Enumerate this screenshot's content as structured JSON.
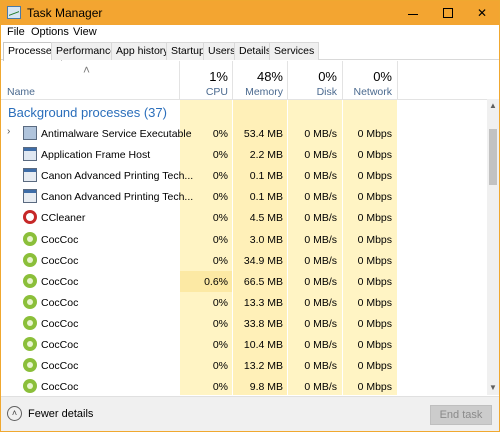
{
  "window": {
    "title": "Task Manager"
  },
  "menu": [
    "File",
    "Options",
    "View"
  ],
  "tabs": [
    "Processes",
    "Performance",
    "App history",
    "Startup",
    "Users",
    "Details",
    "Services"
  ],
  "active_tab": "Processes",
  "columns": {
    "name": "Name",
    "cpu": {
      "pct": "1%",
      "label": "CPU"
    },
    "memory": {
      "pct": "48%",
      "label": "Memory"
    },
    "disk": {
      "pct": "0%",
      "label": "Disk"
    },
    "network": {
      "pct": "0%",
      "label": "Network"
    }
  },
  "group": {
    "title": "Background processes (37)"
  },
  "rows": [
    {
      "name": "Antimalware Service Executable",
      "icon": "shield-icon",
      "expandable": true,
      "cpu": "0%",
      "memory": "53.4 MB",
      "disk": "0 MB/s",
      "network": "0 Mbps"
    },
    {
      "name": "Application Frame Host",
      "icon": "app-frame-icon",
      "expandable": false,
      "cpu": "0%",
      "memory": "2.2 MB",
      "disk": "0 MB/s",
      "network": "0 Mbps"
    },
    {
      "name": "Canon Advanced Printing Tech...",
      "icon": "canon-icon",
      "expandable": false,
      "cpu": "0%",
      "memory": "0.1 MB",
      "disk": "0 MB/s",
      "network": "0 Mbps"
    },
    {
      "name": "Canon Advanced Printing Tech...",
      "icon": "canon-icon",
      "expandable": false,
      "cpu": "0%",
      "memory": "0.1 MB",
      "disk": "0 MB/s",
      "network": "0 Mbps"
    },
    {
      "name": "CCleaner",
      "icon": "ccleaner-icon",
      "expandable": false,
      "cpu": "0%",
      "memory": "4.5 MB",
      "disk": "0 MB/s",
      "network": "0 Mbps"
    },
    {
      "name": "CocCoc",
      "icon": "coccoc-icon",
      "expandable": false,
      "cpu": "0%",
      "memory": "3.0 MB",
      "disk": "0 MB/s",
      "network": "0 Mbps"
    },
    {
      "name": "CocCoc",
      "icon": "coccoc-icon",
      "expandable": false,
      "cpu": "0%",
      "memory": "34.9 MB",
      "disk": "0 MB/s",
      "network": "0 Mbps"
    },
    {
      "name": "CocCoc",
      "icon": "coccoc-icon",
      "expandable": false,
      "cpu": "0.6%",
      "memory": "66.5 MB",
      "disk": "0 MB/s",
      "network": "0 Mbps"
    },
    {
      "name": "CocCoc",
      "icon": "coccoc-icon",
      "expandable": false,
      "cpu": "0%",
      "memory": "13.3 MB",
      "disk": "0 MB/s",
      "network": "0 Mbps"
    },
    {
      "name": "CocCoc",
      "icon": "coccoc-icon",
      "expandable": false,
      "cpu": "0%",
      "memory": "33.8 MB",
      "disk": "0 MB/s",
      "network": "0 Mbps"
    },
    {
      "name": "CocCoc",
      "icon": "coccoc-icon",
      "expandable": false,
      "cpu": "0%",
      "memory": "10.4 MB",
      "disk": "0 MB/s",
      "network": "0 Mbps"
    },
    {
      "name": "CocCoc",
      "icon": "coccoc-icon",
      "expandable": false,
      "cpu": "0%",
      "memory": "13.2 MB",
      "disk": "0 MB/s",
      "network": "0 Mbps"
    },
    {
      "name": "CocCoc",
      "icon": "coccoc-icon",
      "expandable": false,
      "cpu": "0%",
      "memory": "9.8 MB",
      "disk": "0 MB/s",
      "network": "0 Mbps"
    }
  ],
  "footer": {
    "fewer_details": "Fewer details",
    "end_task": "End task"
  },
  "colors": {
    "title_bar": "#f3a531",
    "heat_light": "#fff4c4",
    "heat_medium": "#fce9a4",
    "group_title": "#2a6ebb"
  }
}
